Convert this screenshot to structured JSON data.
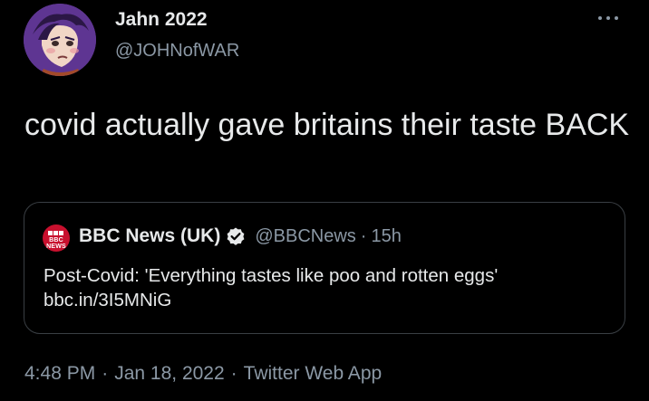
{
  "tweet": {
    "author": {
      "name": "Jahn 2022",
      "handle": "@JOHNofWAR"
    },
    "text": "covid actually gave britains their taste BACK",
    "more_icon": "more-horizontal-icon"
  },
  "quote": {
    "logo_text": "BBC NEWS",
    "author_name": "BBC News (UK)",
    "verified_icon": "verified-badge-icon",
    "handle": "@BBCNews",
    "separator": "·",
    "time": "15h",
    "text_line1": "Post-Covid: 'Everything tastes like poo and rotten eggs'",
    "text_line2": "bbc.in/3I5MNiG"
  },
  "meta": {
    "time": "4:48 PM",
    "separator": "·",
    "date": "Jan 18, 2022",
    "source": "Twitter Web App"
  },
  "colors": {
    "background": "#000000",
    "text_primary": "#e7e9ea",
    "text_secondary": "#8b98a5",
    "border": "#3a3f44",
    "bbc_red": "#c8102e"
  }
}
